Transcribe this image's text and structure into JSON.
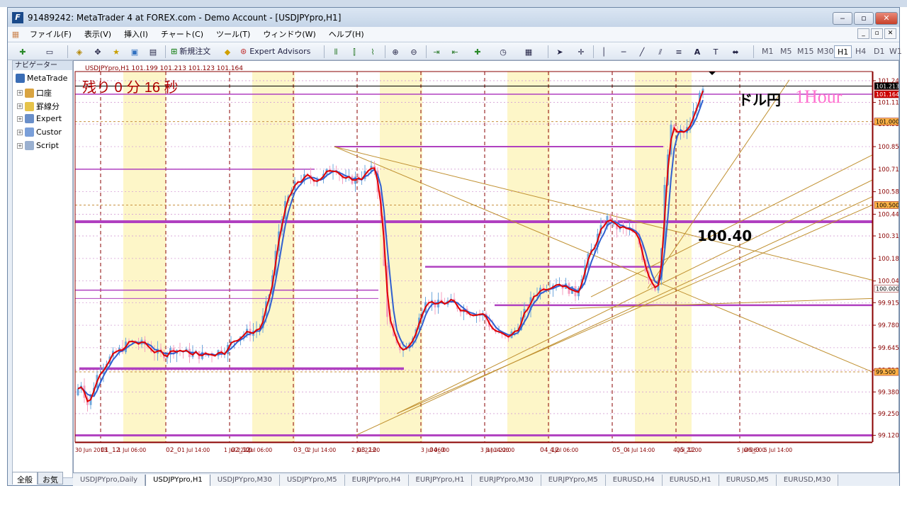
{
  "window": {
    "title": "91489242: MetaTrader 4 at FOREX.com - Demo Account - [USDJPYpro,H1]",
    "icon": "metatrader-icon",
    "buttons": {
      "minimize": "‒",
      "maximize": "▫",
      "close": "✕"
    }
  },
  "menu": [
    "ファイル(F)",
    "表示(V)",
    "挿入(I)",
    "チャート(C)",
    "ツール(T)",
    "ウィンドウ(W)",
    "ヘルプ(H)"
  ],
  "toolbar": {
    "new_order": "新規注文",
    "expert_advisors": "Expert Advisors",
    "timeframes": [
      "M1",
      "M5",
      "M15",
      "M30",
      "H1",
      "H4",
      "D1",
      "W1"
    ],
    "active_timeframe": "H1"
  },
  "navigator": {
    "header": "ナビゲーター",
    "root": "MetaTrade",
    "items": [
      "口座",
      "罫線分",
      "Expert",
      "Custor",
      "Script"
    ],
    "tabs": [
      "全般",
      "お気"
    ]
  },
  "chart": {
    "symbol_info": "USDJPYpro,H1  101.199 101.213 101.123 101.164",
    "countdown": "残り 0 分 16 秒",
    "pair_label": "ドル円",
    "timeframe_label": "1Hour",
    "level_label": "100.40",
    "price_axis": [
      "101.245",
      "101.115",
      "100.985",
      "100.850",
      "100.715",
      "100.580",
      "100.445",
      "100.315",
      "100.180",
      "100.045",
      "99.915",
      "99.780",
      "99.645",
      "99.510",
      "99.380",
      "99.250",
      "99.120"
    ],
    "price_tags": [
      {
        "text": "101.213",
        "color": "#000000"
      },
      {
        "text": "101.164",
        "color": "#cc0000"
      },
      {
        "text": "101.000",
        "color": "#ffb347"
      },
      {
        "text": "100.500",
        "color": "#ffb347"
      },
      {
        "text": "100.000",
        "color": "#ffffff"
      },
      {
        "text": "99.500",
        "color": "#ffb347"
      }
    ],
    "time_axis": [
      "30 Jun 2013",
      "01_12",
      "1 Jul 06:00",
      "02_0",
      "1 Jul 14:00",
      "1 Jul 22:00",
      "02_12",
      "2 Jul 06:00",
      "03_0",
      "2 Jul 14:00",
      "2 Jul 22:00",
      "03_12",
      "3 Jul 06:00",
      "04_0",
      "3 Jul 14:00",
      "3 Jul 22:00",
      "04_12",
      "4 Jul 06:00",
      "05_0",
      "4 Jul 14:00",
      "4 Jul 22:00",
      "05_12",
      "5 Jul 06:00",
      "06_0",
      "5 Jul 14:00"
    ],
    "colors": {
      "bull_candle": "#6fa8dc",
      "bear_candle": "#f4a0c0",
      "ma_fast": "#e00000",
      "ma_slow": "#3060d0",
      "level_line": "#b040c0",
      "trend_line": "#c09030",
      "session_fill": "#fdf6c8"
    }
  },
  "chart_data": {
    "type": "candlestick",
    "title": "USDJPYpro,H1",
    "ylim": [
      99.08,
      101.3
    ],
    "ohlc_current": {
      "open": 101.199,
      "high": 101.213,
      "low": 101.123,
      "close": 101.164
    },
    "horizontal_levels": [
      101.213,
      101.164,
      100.85,
      100.715,
      100.4,
      100.13,
      99.99,
      99.94,
      99.9,
      99.52,
      99.12
    ],
    "key_level": 100.4
  },
  "symbol_tabs": [
    "USDJPYpro,Daily",
    "USDJPYpro,H1",
    "USDJPYpro,M30",
    "USDJPYpro,M5",
    "EURJPYpro,H4",
    "EURJPYpro,H1",
    "EURJPYpro,M30",
    "EURJPYpro,M5",
    "EURUSD,H4",
    "EURUSD,H1",
    "EURUSD,M5",
    "EURUSD,M30"
  ],
  "active_symbol_tab": "USDJPYpro,H1"
}
